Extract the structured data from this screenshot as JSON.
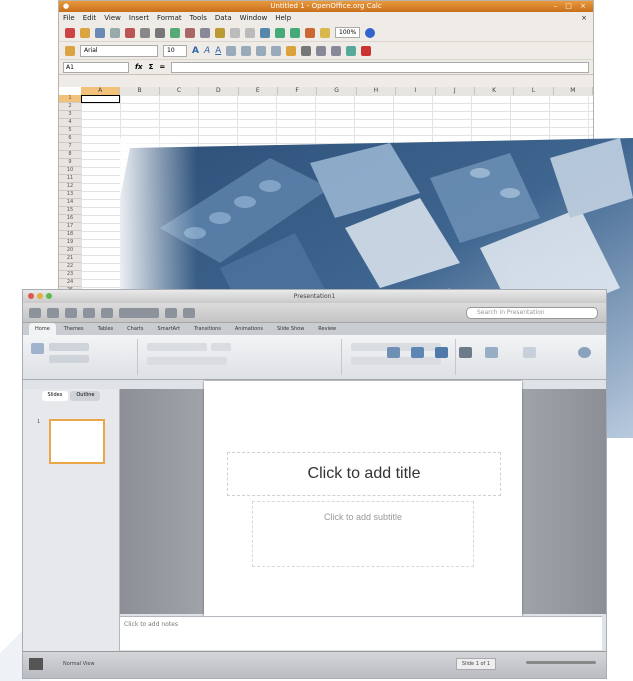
{
  "calc": {
    "title": "Untitled 1 - OpenOffice.org Calc",
    "menu": [
      "File",
      "Edit",
      "View",
      "Insert",
      "Format",
      "Tools",
      "Data",
      "Window",
      "Help"
    ],
    "font_name": "Arial",
    "font_size": "10",
    "zoom": "100%",
    "name_box": "A1",
    "fx_label": "fx",
    "sum_label": "Σ",
    "eq_label": "=",
    "columns": [
      "A",
      "B",
      "C",
      "D",
      "E",
      "F",
      "G",
      "H",
      "I",
      "J",
      "K",
      "L",
      "M"
    ],
    "rows": [
      "1",
      "2",
      "3",
      "4",
      "5",
      "6",
      "7",
      "8",
      "9",
      "10",
      "11",
      "12",
      "13",
      "14",
      "15",
      "16",
      "17",
      "18",
      "19",
      "20",
      "21",
      "22",
      "23",
      "24",
      "25"
    ]
  },
  "ppt": {
    "title": "Presentation1",
    "search_placeholder": "Search in Presentation",
    "ribbon_tabs": [
      "Home",
      "Themes",
      "Tables",
      "Charts",
      "SmartArt",
      "Transitions",
      "Animations",
      "Slide Show",
      "Review"
    ],
    "side_tabs": [
      "Slides",
      "Outline"
    ],
    "slide_number": "1",
    "title_placeholder": "Click to add title",
    "subtitle_placeholder": "Click to add subtitle",
    "notes_placeholder": "Click to add notes",
    "status_view": "Normal View",
    "status_page": "Slide 1 of 1"
  },
  "colors": {
    "calc_title": "#d9822b",
    "photo_tint": "#3e6186",
    "ppt_accent": "#e9a74a"
  }
}
